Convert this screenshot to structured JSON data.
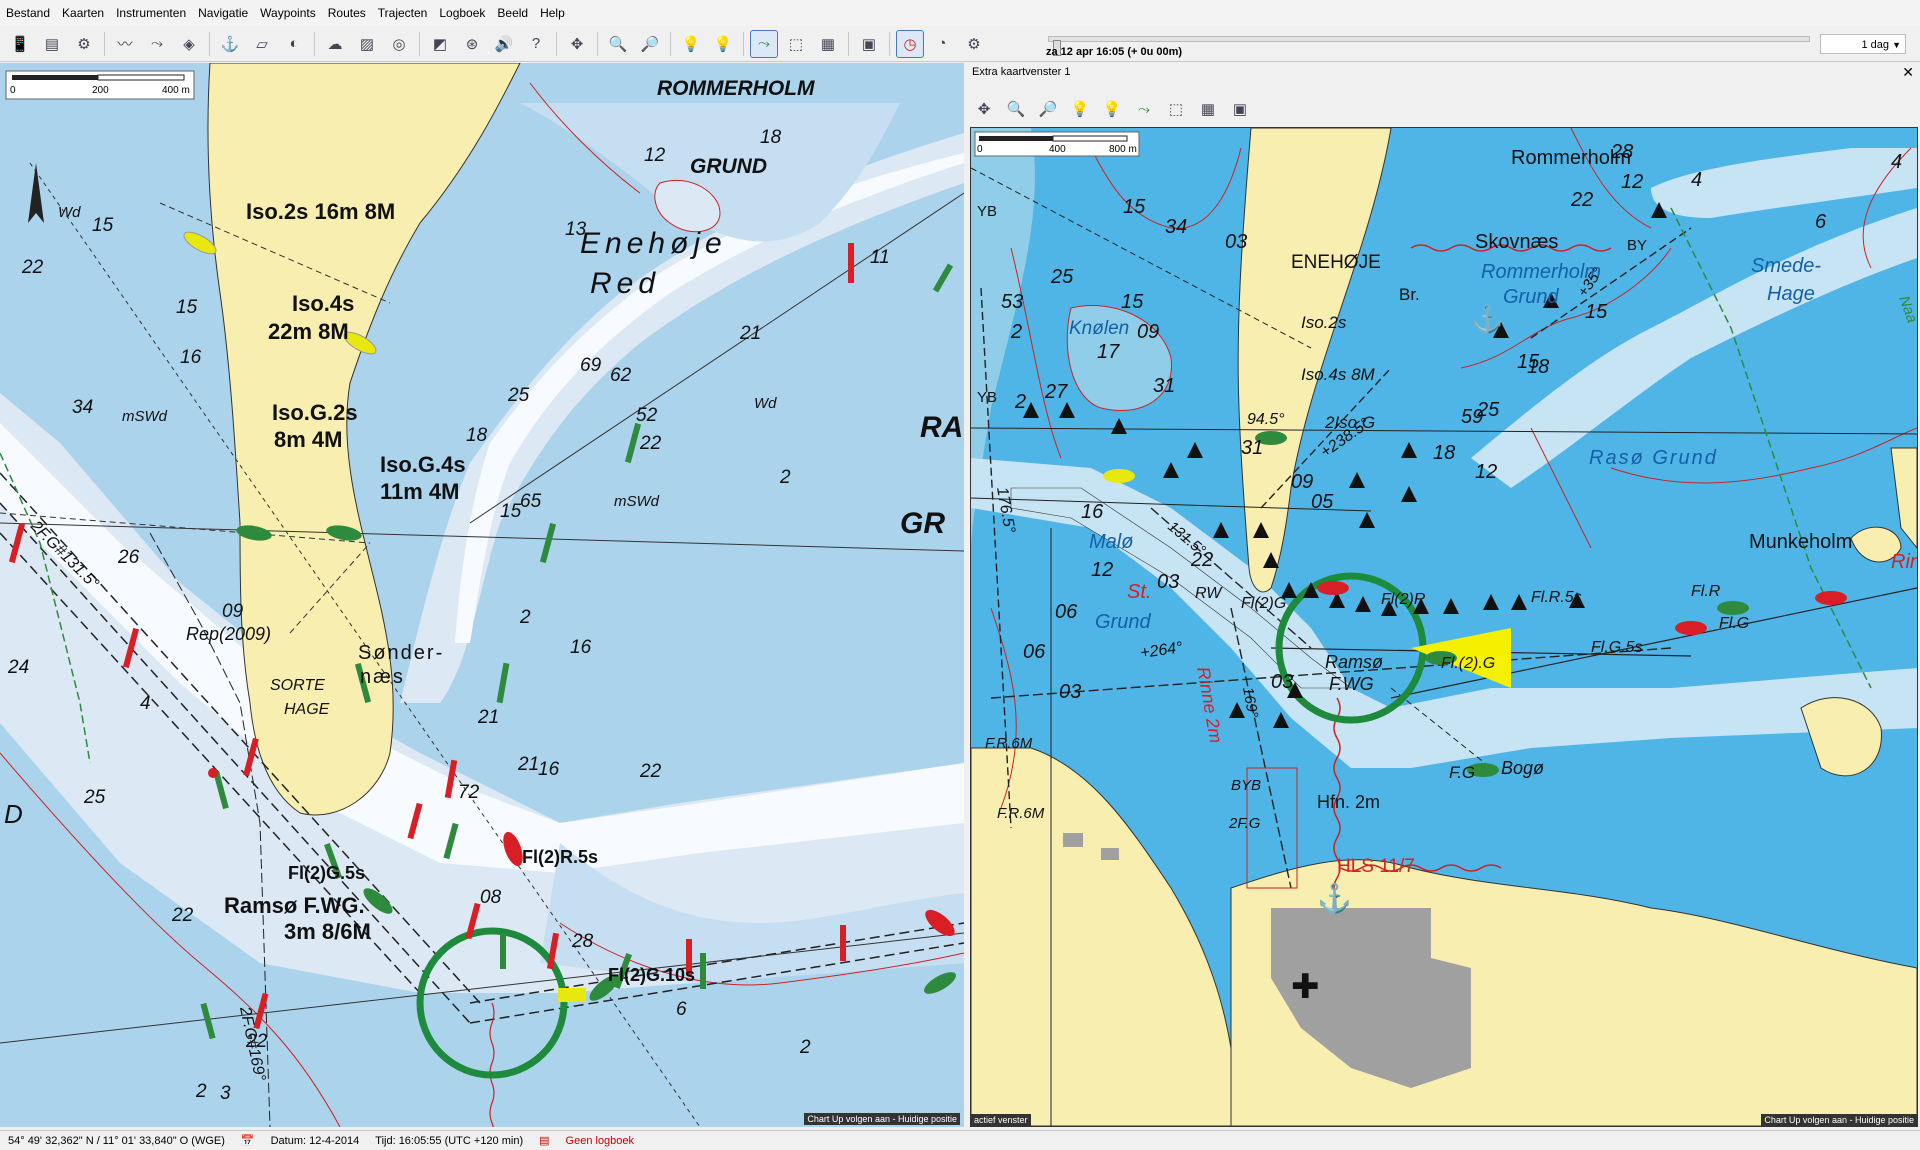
{
  "menu": [
    "Bestand",
    "Kaarten",
    "Instrumenten",
    "Navigatie",
    "Waypoints",
    "Routes",
    "Trajecten",
    "Logboek",
    "Beeld",
    "Help"
  ],
  "toolbar": {
    "icons": [
      "phone-icon",
      "instrument-icon",
      "instrument2-icon",
      "track-icon",
      "route-icon",
      "waypoint-icon",
      "anchor-icon",
      "chart-stack-icon",
      "globe-icon",
      "weather-icon",
      "photo-icon",
      "compass-icon",
      "chart-tools-icon",
      "steering-icon",
      "sound-icon",
      "help-icon",
      "move-icon",
      "zoom-in-icon",
      "zoom-out-icon",
      "light-off-icon",
      "light-on-icon",
      "route-edit-icon",
      "chart-up-icon",
      "window-layout-icon",
      "chart-box-icon",
      "clock-icon",
      "tide-icon",
      "settings-icon"
    ]
  },
  "time": {
    "label": "za 12 apr 16:05  (+ 0u 00m)",
    "duration": "1 dag"
  },
  "left_chart": {
    "scale": {
      "t0": "0",
      "t1": "200",
      "t2": "400 m"
    },
    "labels": {
      "rommerholm": "ROMMERHOLM",
      "grund": "GRUND",
      "enehoje": "Enehøje",
      "red": "Red",
      "ra": "RA",
      "gr": "GR",
      "light1": "Iso.2s 16m 8M",
      "light2a": "Iso.4s",
      "light2b": "22m 8M",
      "light3a": "Iso.G.2s",
      "light3b": "8m 4M",
      "light4a": "Iso.G.4s",
      "light4b": "11m 4M",
      "sondera": "Sønder-",
      "sonderb": "næs",
      "sorte": "SORTE",
      "hage": "HAGE",
      "rep": "Rep(2009)",
      "ramsoa": "Ramsø  F.WG.",
      "ramsob": "3m 8/6M",
      "fl2g5": "Fl(2)G.5s",
      "fl2r5": "Fl(2)R.5s",
      "fl2g10": "Fl(2)G.10s",
      "bearing1": "2F.G#131.5°",
      "bearing2": "2F.G#169°",
      "wd": "Wd",
      "mswd": "mSWd",
      "d": "D",
      "chartup": "Chart Up volgen aan - Huidige positie"
    },
    "depths": [
      "15",
      "22",
      "34",
      "26",
      "09",
      "24",
      "25",
      "15",
      "16",
      "12",
      "18",
      "13",
      "11",
      "21",
      "69",
      "62",
      "25",
      "52",
      "22",
      "18",
      "15",
      "65",
      "16",
      "21",
      "16",
      "72",
      "21",
      "22",
      "08",
      "28",
      "22",
      "22",
      "3",
      "6",
      "4",
      "2",
      "2",
      "2",
      "2"
    ]
  },
  "right_chart": {
    "title": "Extra kaartvenster 1",
    "scale": {
      "t0": "0",
      "t1": "400",
      "t2": "800 m"
    },
    "labels": {
      "rommerholm": "Rommerholm",
      "skovnaes": "Skovnæs",
      "enehoje": "ENEHØJE",
      "br": "Br.",
      "rgrund1": "Rommerholm",
      "rgrund2": "Grund",
      "smede1": "Smede-",
      "smede2": "Hage",
      "knolen": "Knølen",
      "iso2s": "Iso.2s",
      "iso4s": "Iso.4s 8M",
      "iso2g": "2Iso.G",
      "raso": "Rasø  Grund",
      "munkeholm": "Munkeholm",
      "rin": "Rin",
      "malo": "Malø",
      "st": "St.",
      "grund": "Grund",
      "fl2g": "Fl(2)G",
      "fl2r": "Fl(2)R",
      "flr5": "Fl.R.5s",
      "flr": "Fl.R",
      "flg5": "Fl.G.5s",
      "flg": "Fl.G",
      "fl2gb": "Fl.(2).G",
      "ramso1": "Ramsø",
      "ramso2": "F.WG",
      "rw": "RW",
      "rinne": "Rinne 2m",
      "fg": "F.G",
      "bogo": "Bogø",
      "fr6m": "F.R.6M",
      "fr6m2": "F.R.6M",
      "hfn": "Hfn. 2m",
      "hls": "HLS 11/7",
      "bearing1": "131.5°",
      "bearing2": "+238.5°",
      "bearing3": "94.5°",
      "bearing4": "176.5°",
      "bearing5": "+264°",
      "bearing6": "169°",
      "bearing7": "+35°",
      "naa": "Naa",
      "bby": "BYB",
      "by": "BY",
      "yb": "YB",
      "yb2": "YB",
      "twofg": "2F.G",
      "actief": "actief venster",
      "chartup": "Chart Up volgen aan - Huidige positie"
    },
    "depths": [
      "15",
      "34",
      "03",
      "25",
      "15",
      "09",
      "17",
      "27",
      "31",
      "31",
      "09",
      "05",
      "15",
      "59",
      "18",
      "25",
      "18",
      "12",
      "28",
      "12",
      "4",
      "6",
      "4",
      "53",
      "2",
      "2",
      "15",
      "16",
      "12",
      "06",
      "22",
      "03",
      "06",
      "03",
      "03",
      "22"
    ]
  },
  "status": {
    "position": "54° 49' 32,362\" N / 11° 01' 33,840\" O (WGE)",
    "date": "Datum: 12-4-2014",
    "time": "Tijd: 16:05:55 (UTC +120 min)",
    "log": "Geen logboek"
  },
  "colors": {
    "land": "#f7eeb0",
    "shallow": "#dce8f4",
    "mid": "#acd3ec",
    "deep_right": "#4fb5e6",
    "port": "#2e8b3e",
    "starboard": "#d81f26",
    "ring": "#1e8a3c"
  }
}
